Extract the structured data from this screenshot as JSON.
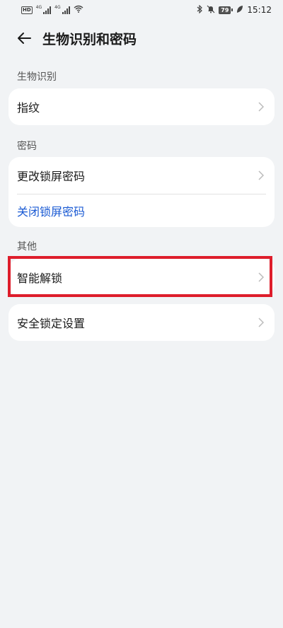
{
  "status_bar": {
    "hd_label": "HD",
    "sim1_label": "4G",
    "sim2_label": "4G",
    "battery_level": "79",
    "time": "15:12"
  },
  "header": {
    "title": "生物识别和密码"
  },
  "sections": {
    "biometrics": {
      "header": "生物识别",
      "items": [
        {
          "label": "指纹"
        }
      ]
    },
    "password": {
      "header": "密码",
      "items": [
        {
          "label": "更改锁屏密码"
        },
        {
          "label": "关闭锁屏密码"
        }
      ]
    },
    "other": {
      "header": "其他",
      "items": [
        {
          "label": "智能解锁"
        },
        {
          "label": "安全锁定设置"
        }
      ]
    }
  },
  "colors": {
    "background": "#f1f3f5",
    "card": "#ffffff",
    "link": "#1a5ad3",
    "highlight": "#de1d2b"
  }
}
